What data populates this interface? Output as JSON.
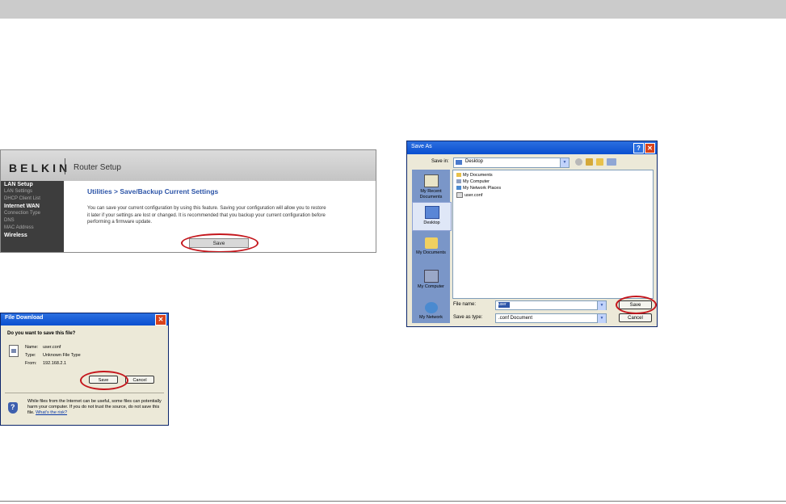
{
  "router": {
    "logo": "BELKIN",
    "title": "Router Setup",
    "nav": [
      {
        "label": "LAN Setup",
        "header": true
      },
      {
        "label": "LAN Settings",
        "header": false
      },
      {
        "label": "DHCP Client List",
        "header": false
      },
      {
        "label": "Internet WAN",
        "header": true
      },
      {
        "label": "Connection Type",
        "header": false
      },
      {
        "label": "DNS",
        "header": false
      },
      {
        "label": "MAC Address",
        "header": false
      },
      {
        "label": "Wireless",
        "header": true
      }
    ],
    "heading": "Utilities > Save/Backup Current Settings",
    "description": "You can save your current configuration by using this feature. Saving your configuration will allow you to restore it later if your settings are lost or changed. It is recommended that you backup your current configuration before performing a firmware update.",
    "save_label": "Save"
  },
  "file_download": {
    "title": "File Download",
    "close": "✕",
    "question": "Do you want to save this file?",
    "name_label": "Name:",
    "name_value": "user.conf",
    "type_label": "Type:",
    "type_value": "Unknown File Type",
    "from_label": "From:",
    "from_value": "192.168.2.1",
    "save_label": "Save",
    "cancel_label": "Cancel",
    "warning": "While files from the Internet can be useful, some files can potentially harm your computer. If you do not trust the source, do not save this file.",
    "warning_link": "What's the risk?"
  },
  "save_as": {
    "title": "Save As",
    "help": "?",
    "close": "✕",
    "save_in_label": "Save in:",
    "save_in_value": "Desktop",
    "places": [
      "My Recent Documents",
      "Desktop",
      "My Documents",
      "My Computer",
      "My Network"
    ],
    "files": [
      "My Documents",
      "My Computer",
      "My Network Places",
      "user.conf"
    ],
    "file_name_label": "File name:",
    "file_name_value": "user",
    "save_as_type_label": "Save as type:",
    "save_as_type_value": ".conf Document",
    "save_label": "Save",
    "cancel_label": "Cancel"
  },
  "colors": {
    "highlight_ring": "#c4161c",
    "titlebar": "#0a4fd0",
    "belkin_link": "#2d55a8"
  }
}
